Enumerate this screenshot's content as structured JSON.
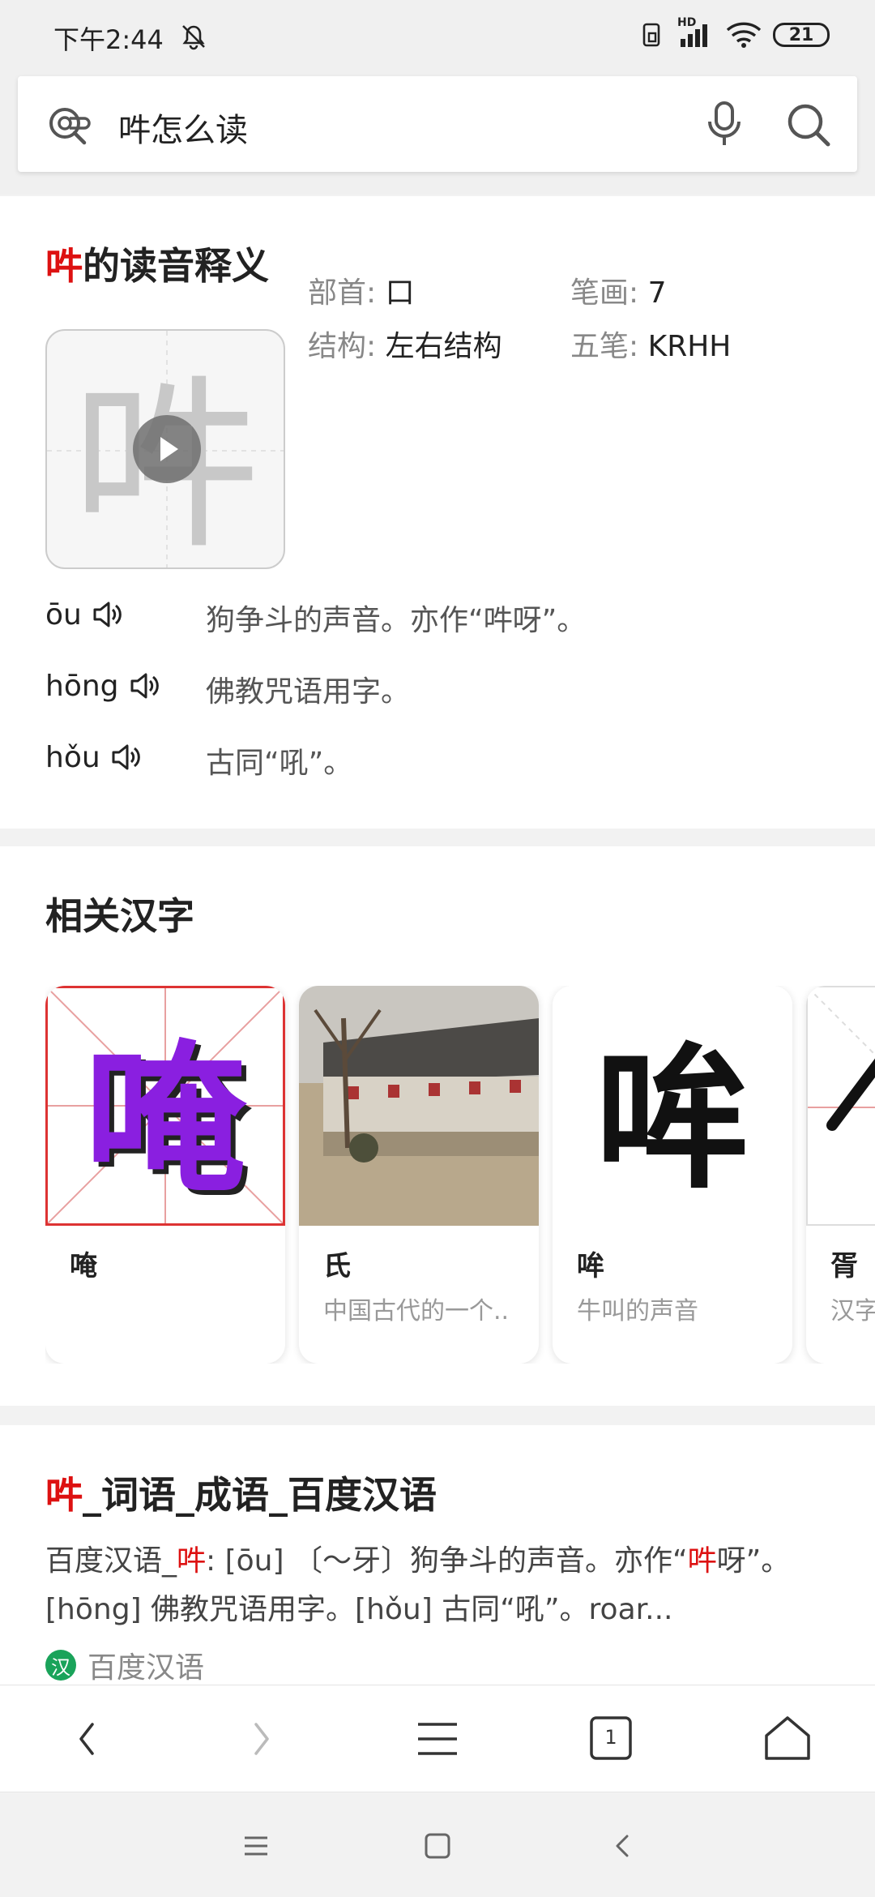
{
  "status_bar": {
    "time": "下午2:44",
    "network": "HD",
    "battery": "21"
  },
  "search": {
    "query": "吽怎么读"
  },
  "reading": {
    "title_char": "吽",
    "title_rest": "的读音释义",
    "glyph": "吽",
    "radical_label": "部首:",
    "radical_value": "口",
    "strokes_label": "笔画:",
    "strokes_value": "7",
    "structure_label": "结构:",
    "structure_value": "左右结构",
    "wubi_label": "五笔:",
    "wubi_value": "KRHH",
    "pronunciations": [
      {
        "pinyin": "ōu",
        "definition": "狗争斗的声音。亦作“吽呀”。"
      },
      {
        "pinyin": "hōng",
        "definition": "佛教咒语用字。"
      },
      {
        "pinyin": "hǒu",
        "definition": "古同“吼”。"
      }
    ]
  },
  "related": {
    "title": "相关汉字",
    "tiles": [
      {
        "name": "唵",
        "desc": "",
        "glyph": "唵"
      },
      {
        "name": "氏",
        "desc": "中国古代的一个..",
        "glyph": ""
      },
      {
        "name": "哞",
        "desc": "牛叫的声音",
        "glyph": "哞"
      },
      {
        "name": "胥",
        "desc": "汉字",
        "glyph": ""
      }
    ]
  },
  "result": {
    "title_char": "吽",
    "title_rest": "_词语_成语_百度汉语",
    "line1_prefix": "百度汉语_",
    "line1_char": "吽",
    "line1_mid": ": [ōu] 〔～牙〕狗争斗的声音。亦作“",
    "line1_char2": "吽",
    "line1_suffix": "呀”。",
    "line2": "[hōng] 佛教咒语用字。[hǒu] 古同“吼”。roar...",
    "source_icon": "汉",
    "source": "百度汉语"
  },
  "toolbar": {
    "tabs_count": "1"
  },
  "colors": {
    "highlight": "#dd1111",
    "tile1_glyph": "#8a1fe0",
    "source_icon": "#1aa35a"
  }
}
